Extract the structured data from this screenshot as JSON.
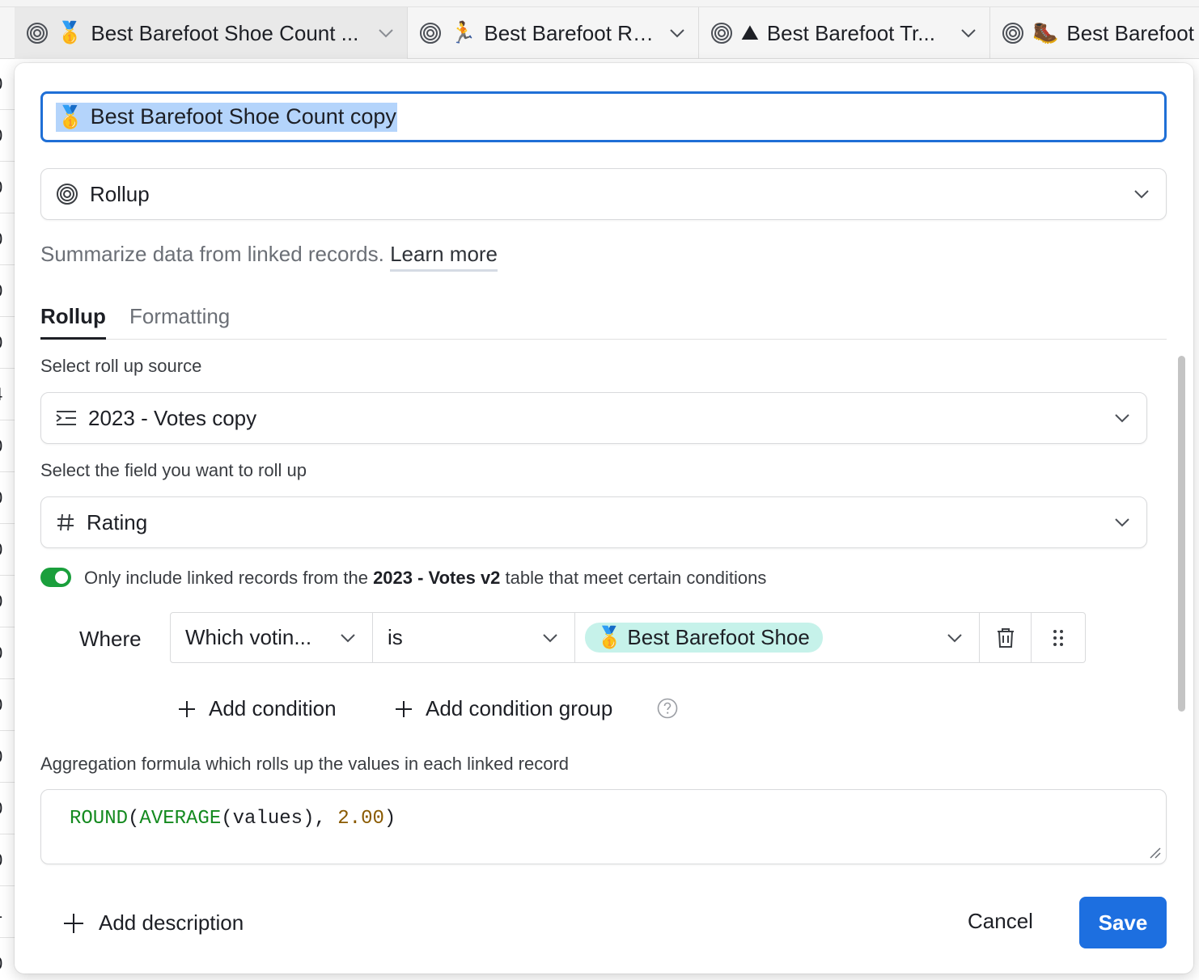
{
  "column_headers": [
    {
      "emoji": "🥇",
      "label": "Best Barefoot Shoe Count ...",
      "active": true
    },
    {
      "emoji": "🏃",
      "label": "Best Barefoot Ro...",
      "active": false
    },
    {
      "emoji": "⛰",
      "label": "Best Barefoot Tr...",
      "active": false
    },
    {
      "emoji": "🥾",
      "label": "Best Barefoot",
      "active": false
    }
  ],
  "gutter_digits": [
    "0",
    "0",
    "0",
    "0",
    "0",
    "0",
    "4",
    "0",
    "0",
    "0",
    "0",
    "0",
    "0",
    "0",
    "0",
    "0",
    "1",
    "0"
  ],
  "modal": {
    "field_name_emoji": "🥇",
    "field_name": "Best Barefoot Shoe Count copy",
    "field_type": "Rollup",
    "description": "Summarize data from linked records.",
    "learn_more": "Learn more",
    "tabs": [
      {
        "label": "Rollup",
        "active": true
      },
      {
        "label": "Formatting",
        "active": false
      }
    ],
    "source_label": "Select roll up source",
    "source_value": "2023 - Votes copy",
    "field_label": "Select the field you want to roll up",
    "field_value": "Rating",
    "toggle_on": true,
    "condition_prefix": "Only include linked records from the",
    "condition_table": "2023 - Votes v2",
    "condition_suffix": "table that meet certain conditions",
    "where_label": "Where",
    "filter": {
      "field": "Which votin...",
      "operator": "is",
      "value_emoji": "🥇",
      "value": "Best Barefoot Shoe"
    },
    "add_condition": "Add condition",
    "add_condition_group": "Add condition group",
    "aggregation_label": "Aggregation formula which rolls up the values in each linked record",
    "formula": {
      "round": "ROUND",
      "open1": "(",
      "average": "AVERAGE",
      "args": "(values), ",
      "decimals": "2.00",
      "close": ")"
    },
    "add_description": "Add description",
    "cancel": "Cancel",
    "save": "Save"
  },
  "colors": {
    "accent": "#1d6fe0",
    "toggle_on": "#1a9f3c",
    "pill_bg": "#c6f2ea",
    "formula_fn": "#148a1f",
    "formula_num": "#8a5a00"
  }
}
